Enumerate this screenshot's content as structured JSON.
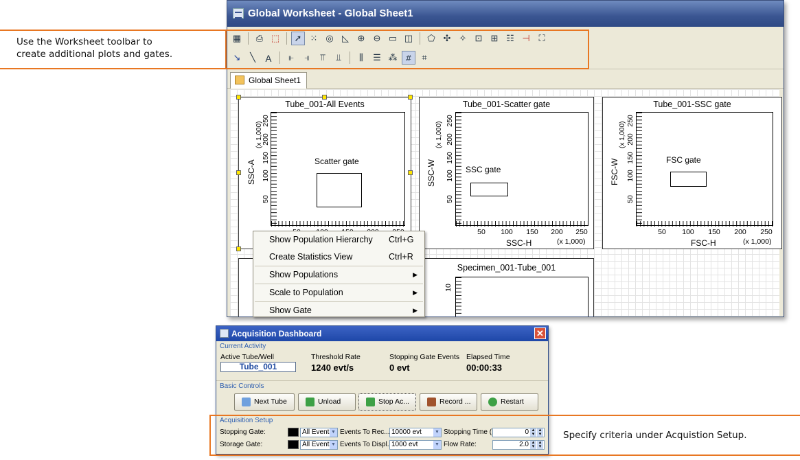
{
  "callouts": {
    "toolbar_line1": "Use the Worksheet toolbar to",
    "toolbar_line2": "create additional plots and gates.",
    "setup": "Specify criteria under Acquistion Setup."
  },
  "worksheet": {
    "title": "Global Worksheet - Global Sheet1",
    "tab": "Global Sheet1",
    "toolbar_icons_row1": [
      "worksheet-icon",
      "print-icon",
      "pdf-icon",
      "pointer-icon",
      "dot-plot-icon",
      "contour-plot-icon",
      "histogram-icon",
      "zoom-in-icon",
      "zoom-out-icon",
      "rect-gate-icon",
      "quad-gate-icon",
      "polygon-gate-icon",
      "snap-gate-icon",
      "autogate-icon",
      "interval-gate-icon",
      "grid-gate-icon",
      "bisector-gate-icon",
      "hinged-gate-icon"
    ],
    "toolbar_icons_row2": [
      "arrow-icon",
      "line-icon",
      "text-icon",
      "align-left-icon",
      "align-right-icon",
      "align-top-icon",
      "align-bottom-icon",
      "distribute-h-icon",
      "distribute-v-icon",
      "grid-icon",
      "show-grid-icon",
      "snap-grid-icon"
    ]
  },
  "plots": [
    {
      "title": "Tube_001-All Events",
      "y_label": "SSC-A",
      "y_scale": "(x 1,000)",
      "y_ticks": [
        "50",
        "100",
        "150",
        "200",
        "250"
      ],
      "x_ticks": [
        "50",
        "100",
        "150",
        "200",
        "250"
      ],
      "gate_label": "Scatter gate"
    },
    {
      "title": "Tube_001-Scatter gate",
      "y_label": "SSC-W",
      "y_scale": "(x 1,000)",
      "y_ticks": [
        "50",
        "100",
        "150",
        "200",
        "250"
      ],
      "x_ticks": [
        "50",
        "100",
        "150",
        "200",
        "250"
      ],
      "x_label": "SSC-H",
      "x_scale": "(x 1,000)",
      "gate_label": "SSC gate"
    },
    {
      "title": "Tube_001-SSC gate",
      "y_label": "FSC-W",
      "y_scale": "(x 1,000)",
      "y_ticks": [
        "50",
        "100",
        "150",
        "200",
        "250"
      ],
      "x_ticks": [
        "50",
        "100",
        "150",
        "200",
        "250"
      ],
      "x_label": "FSC-H",
      "x_scale": "(x 1,000)",
      "gate_label": "FSC gate"
    },
    {
      "title": "Specimen_001-Tube_001",
      "y_ticks": [
        "10"
      ]
    }
  ],
  "context_menu": [
    {
      "label": "Show Population Hierarchy",
      "shortcut": "Ctrl+G",
      "submenu": false
    },
    {
      "label": "Create Statistics View",
      "shortcut": "Ctrl+R",
      "submenu": false
    },
    {
      "label": "Show Populations",
      "shortcut": "",
      "submenu": true
    },
    {
      "label": "Scale to Population",
      "shortcut": "",
      "submenu": true
    },
    {
      "label": "Show Gate",
      "shortcut": "",
      "submenu": true
    }
  ],
  "dashboard": {
    "title": "Acquisition Dashboard",
    "current_activity_label": "Current Activity",
    "active_tube_label": "Active Tube/Well",
    "active_tube_value": "Tube_001",
    "threshold_rate_label": "Threshold Rate",
    "threshold_rate_value": "1240 evt/s",
    "stopping_events_label": "Stopping Gate Events",
    "stopping_events_value": "0 evt",
    "elapsed_label": "Elapsed Time",
    "elapsed_value": "00:00:33",
    "basic_controls_label": "Basic Controls",
    "buttons": {
      "next_tube": "Next Tube",
      "unload": "Unload",
      "stop": "Stop Ac...",
      "record": "Record ...",
      "restart": "Restart"
    },
    "setup_label": "Acquisition Setup",
    "stopping_gate_label": "Stopping Gate:",
    "stopping_gate_value": "All Events",
    "events_to_record_label": "Events To Rec...",
    "events_to_record_value": "10000 evt",
    "stopping_time_label": "Stopping Time (...",
    "stopping_time_value": "0",
    "storage_gate_label": "Storage Gate:",
    "storage_gate_value": "All Events",
    "events_to_display_label": "Events To Displ...",
    "events_to_display_value": "1000 evt",
    "flow_rate_label": "Flow Rate:",
    "flow_rate_value": "2.0"
  },
  "colors": {
    "callout_border": "#e87722",
    "title_bar": "#3a5591",
    "dashboard_title": "#1e47a8"
  }
}
